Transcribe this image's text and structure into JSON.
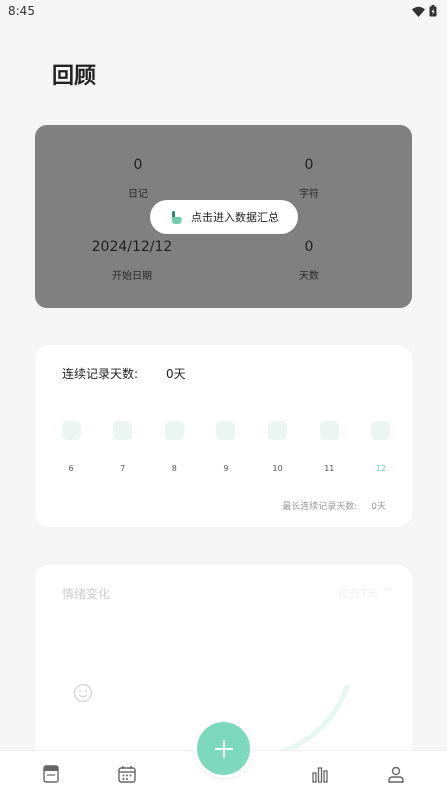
{
  "status_bar": {
    "time": "8:45",
    "icons": [
      "wifi-icon",
      "battery-icon"
    ]
  },
  "header": {
    "title": "回顾"
  },
  "stats": {
    "diary_count": "0",
    "diary_label": "日记",
    "char_count": "0",
    "char_label": "字符",
    "start_date": "2024/12/12",
    "start_label": "开始日期",
    "days_count": "0",
    "days_label": "天数",
    "summary_button": "点击进入数据汇总"
  },
  "streak": {
    "label": "连续记录天数:",
    "value": "0天",
    "days": [
      {
        "label": "6"
      },
      {
        "label": "7"
      },
      {
        "label": "8"
      },
      {
        "label": "9"
      },
      {
        "label": "10"
      },
      {
        "label": "11"
      },
      {
        "label": "12",
        "today": true
      }
    ],
    "longest_label": "最长连续记录天数:",
    "longest_value": "0天"
  },
  "mood": {
    "title": "情绪变化",
    "range": "过去7天"
  },
  "colors": {
    "accent": "#7dd9bb",
    "stats_bg": "#808080",
    "streak_box": "#ebf5f1"
  },
  "bottom_nav": {
    "items": [
      "diary-book-icon",
      "calendar-icon",
      "add-icon",
      "bar-chart-icon",
      "profile-icon"
    ]
  }
}
